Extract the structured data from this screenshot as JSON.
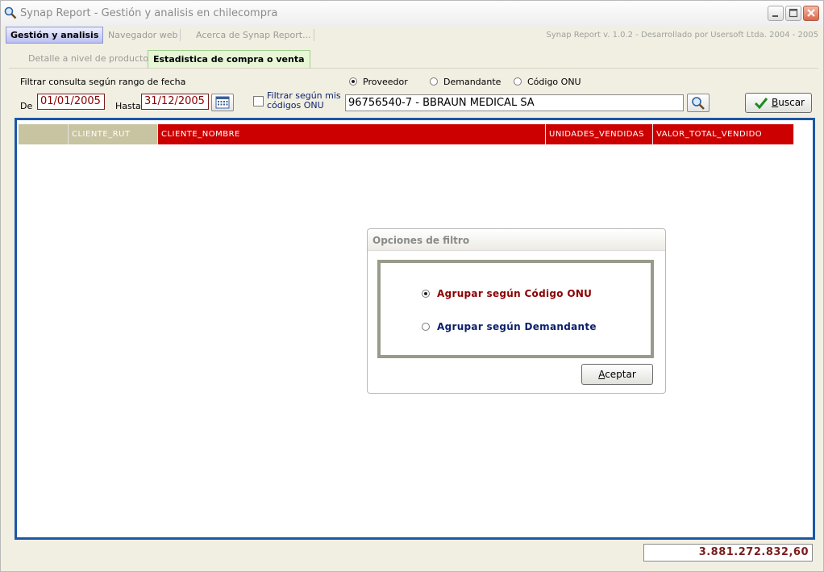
{
  "window": {
    "title": "Synap Report - Gestión y analisis en chilecompra"
  },
  "menu": {
    "tabs": [
      "Gestión y analisis",
      "Navegador web",
      "Acerca de Synap Report..."
    ],
    "version_text": "Synap Report v. 1.0.2 - Desarrollado por Usersoft Ltda. 2004 - 2005"
  },
  "subtabs": [
    "Detalle a nivel de producto",
    "Estadistica de compra o venta"
  ],
  "filters": {
    "range_label": "Filtrar consulta según rango de fecha",
    "from_label": "De",
    "from_value": "01/01/2005",
    "to_label": "Hasta",
    "to_value": "31/12/2005",
    "onu_filter_label_line1": "Filtrar según mis",
    "onu_filter_label_line2": "códigos ONU",
    "onu_filter_checked": false,
    "radio_options": [
      "Proveedor",
      "Demandante",
      "Código ONU"
    ],
    "radio_selected": "Proveedor",
    "provider_value": "96756540-7 - BBRAUN MEDICAL SA",
    "search_button": "Buscar"
  },
  "grid": {
    "columns": [
      "",
      "CLIENTE_RUT",
      "CLIENTE_NOMBRE",
      "UNIDADES_VENDIDAS",
      "VALOR_TOTAL_VENDIDO"
    ],
    "rows": []
  },
  "dialog": {
    "title": "Opciones de filtro",
    "options": [
      "Agrupar según Código ONU",
      "Agrupar según Demandante"
    ],
    "selected": "Agrupar según Código ONU",
    "accept_button": "Aceptar"
  },
  "total": "3.881.272.832,60",
  "colors": {
    "header_red": "#cc0000",
    "header_tan": "#c8c3a0",
    "grid_border": "#1b57a6",
    "option1_color": "#8b0000",
    "option2_color": "#0b1f6b"
  }
}
